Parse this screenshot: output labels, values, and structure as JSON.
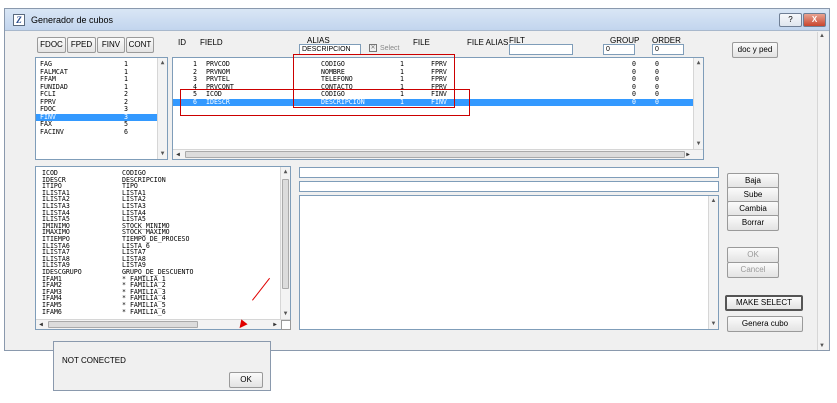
{
  "window": {
    "title": "Generador de cubos",
    "help_label": "?",
    "close_label": "X",
    "app_icon_glyph": "Z"
  },
  "tabs": [
    "FDOC",
    "FPED",
    "FINV",
    "CONT"
  ],
  "table_list": {
    "rows": [
      {
        "name": "FAG",
        "count": "1"
      },
      {
        "name": "FALMCAT",
        "count": "1"
      },
      {
        "name": "FFAM",
        "count": "1"
      },
      {
        "name": "FUNIDAD",
        "count": "1"
      },
      {
        "name": "FCLI",
        "count": "2"
      },
      {
        "name": "FPRV",
        "count": "2"
      },
      {
        "name": "FDOC",
        "count": "3"
      },
      {
        "name": "FINV",
        "count": "3"
      },
      {
        "name": "FAX",
        "count": "5"
      },
      {
        "name": "FACINV",
        "count": "6"
      }
    ],
    "selected_index": 7
  },
  "grid_headers": {
    "id": "ID",
    "field": "FIELD",
    "alias": "ALIAS",
    "file": "FILE",
    "file_alias": "FILE ALIAS",
    "filt": "FILT",
    "group": "GROUP",
    "order": "ORDER"
  },
  "grid_inputs": {
    "alias_value": "DESCRIPCION",
    "select_label": "Select",
    "filt_value": "",
    "group_value": "0",
    "order_value": "0"
  },
  "grid_rows": [
    {
      "id": "1",
      "field": "PRVCOD",
      "alias": "CODIGO",
      "n": "1",
      "file": "FPRV",
      "group": "0",
      "order": "0"
    },
    {
      "id": "2",
      "field": "PRVNOM",
      "alias": "NOMBRE",
      "n": "1",
      "file": "FPRV",
      "group": "0",
      "order": "0"
    },
    {
      "id": "3",
      "field": "PRVTEL",
      "alias": "TELEFONO",
      "n": "1",
      "file": "FPRV",
      "group": "0",
      "order": "0"
    },
    {
      "id": "4",
      "field": "PRVCONT",
      "alias": "CONTACTO",
      "n": "1",
      "file": "FPRV",
      "group": "0",
      "order": "0"
    },
    {
      "id": "5",
      "field": "ICOD",
      "alias": "CODIGO",
      "n": "1",
      "file": "FINV",
      "group": "0",
      "order": "0"
    },
    {
      "id": "6",
      "field": "IDESCR",
      "alias": "DESCRIPCION",
      "n": "1",
      "file": "FINV",
      "group": "0",
      "order": "0"
    }
  ],
  "grid_selected_index": 5,
  "doc_ped_label": "doc y ped",
  "fields_list": [
    {
      "code": "ICOD",
      "desc": "CODIGO"
    },
    {
      "code": "IDESCR",
      "desc": "DESCRIPCION"
    },
    {
      "code": "ITIPO",
      "desc": "TIPO"
    },
    {
      "code": "ILISTA1",
      "desc": "LISTA1"
    },
    {
      "code": "ILISTA2",
      "desc": "LISTA2"
    },
    {
      "code": "ILISTA3",
      "desc": "LISTA3"
    },
    {
      "code": "ILISTA4",
      "desc": "LISTA4"
    },
    {
      "code": "ILISTA5",
      "desc": "LISTA5"
    },
    {
      "code": "IMINIMO",
      "desc": "STOCK_MINIMO"
    },
    {
      "code": "IMAXIMO",
      "desc": "STOCK_MAXIMO"
    },
    {
      "code": "ITIEMPO",
      "desc": "TIEMPO_DE_PROCESO"
    },
    {
      "code": "ILISTA6",
      "desc": "LISTA_6"
    },
    {
      "code": "ILISTA7",
      "desc": "LISTA7"
    },
    {
      "code": "ILISTA8",
      "desc": "LISTA8"
    },
    {
      "code": "ILISTA9",
      "desc": "LISTA9"
    },
    {
      "code": "IDESCGRUPO",
      "desc": "GRUPO_DE_DESCUENTO"
    },
    {
      "code": "IFAM1",
      "desc": "* FAMILIA_1"
    },
    {
      "code": "IFAM2",
      "desc": "* FAMILIA_2"
    },
    {
      "code": "IFAM3",
      "desc": "* FAMILIA_3"
    },
    {
      "code": "IFAM4",
      "desc": "* FAMILIA_4"
    },
    {
      "code": "IFAM5",
      "desc": "* FAMILIA_5"
    },
    {
      "code": "IFAM6",
      "desc": "* FAMILIA_6"
    }
  ],
  "buttons": {
    "baja": "Baja",
    "sube": "Sube",
    "cambia": "Cambia",
    "borrar": "Borrar",
    "ok": "OK",
    "cancel": "Cancel",
    "make_select": "MAKE SELECT",
    "genera_cubo": "Genera cubo"
  },
  "dialog": {
    "message": "NOT CONECTED",
    "ok_label": "OK"
  },
  "colors": {
    "selection": "#3399ff",
    "highlight_box": "#cc0000",
    "arrow": "#e00000"
  }
}
